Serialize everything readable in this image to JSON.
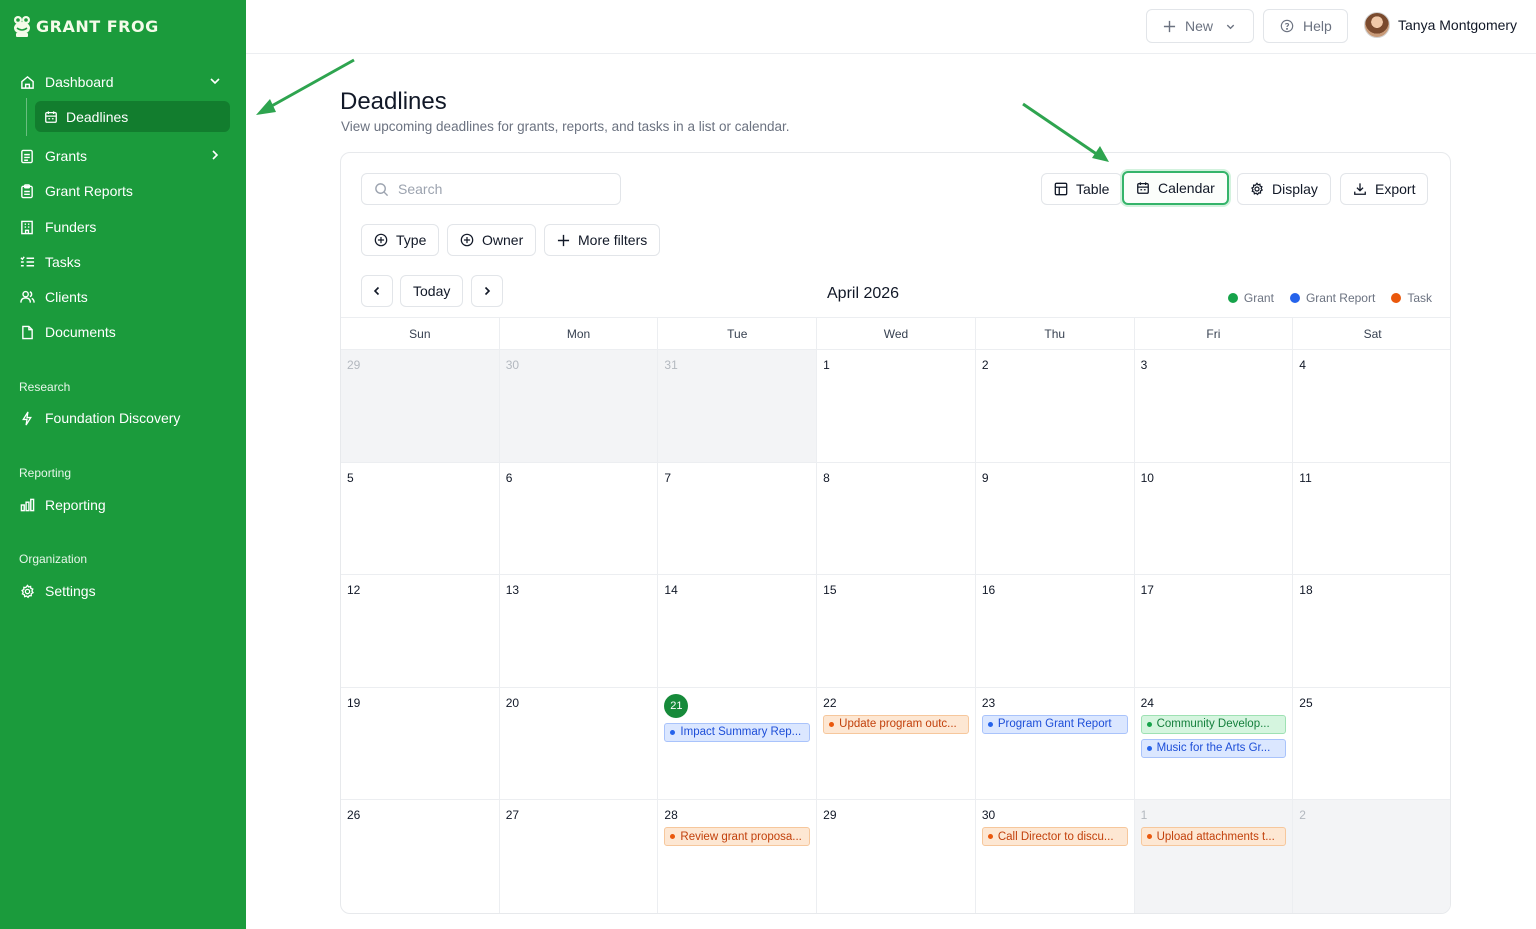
{
  "brand": {
    "name": "GRANT FROG"
  },
  "sidebar": {
    "items": [
      {
        "label": "Dashboard",
        "icon": "home-icon"
      },
      {
        "label": "Deadlines",
        "icon": "calendar-icon"
      },
      {
        "label": "Grants",
        "icon": "document-icon"
      },
      {
        "label": "Grant Reports",
        "icon": "clipboard-icon"
      },
      {
        "label": "Funders",
        "icon": "building-icon"
      },
      {
        "label": "Tasks",
        "icon": "list-check-icon"
      },
      {
        "label": "Clients",
        "icon": "users-icon"
      },
      {
        "label": "Documents",
        "icon": "file-icon"
      }
    ],
    "sections": [
      {
        "title": "Research",
        "items": [
          {
            "label": "Foundation Discovery",
            "icon": "sparkle-icon"
          }
        ]
      },
      {
        "title": "Reporting",
        "items": [
          {
            "label": "Reporting",
            "icon": "bar-chart-icon"
          }
        ]
      },
      {
        "title": "Organization",
        "items": [
          {
            "label": "Settings",
            "icon": "gear-icon"
          }
        ]
      }
    ]
  },
  "topbar": {
    "new_label": "New",
    "help_label": "Help",
    "user_name": "Tanya Montgomery"
  },
  "page": {
    "title": "Deadlines",
    "subtitle": "View upcoming deadlines for grants, reports, and tasks in a list or calendar."
  },
  "toolbar": {
    "search_placeholder": "Search",
    "table_label": "Table",
    "calendar_label": "Calendar",
    "display_label": "Display",
    "export_label": "Export",
    "filters": [
      "Type",
      "Owner",
      "More filters"
    ],
    "today_label": "Today"
  },
  "calendar": {
    "month_title": "April 2026",
    "legend": [
      {
        "label": "Grant",
        "color": "#16a34a"
      },
      {
        "label": "Grant Report",
        "color": "#2563eb"
      },
      {
        "label": "Task",
        "color": "#ea580c"
      }
    ],
    "days_of_week": [
      "Sun",
      "Mon",
      "Tue",
      "Wed",
      "Thu",
      "Fri",
      "Sat"
    ],
    "today": "21",
    "weeks": [
      [
        {
          "n": "29",
          "out": true
        },
        {
          "n": "30",
          "out": true
        },
        {
          "n": "31",
          "out": true
        },
        {
          "n": "1"
        },
        {
          "n": "2"
        },
        {
          "n": "3"
        },
        {
          "n": "4"
        }
      ],
      [
        {
          "n": "5"
        },
        {
          "n": "6"
        },
        {
          "n": "7"
        },
        {
          "n": "8"
        },
        {
          "n": "9"
        },
        {
          "n": "10"
        },
        {
          "n": "11"
        }
      ],
      [
        {
          "n": "12"
        },
        {
          "n": "13"
        },
        {
          "n": "14"
        },
        {
          "n": "15"
        },
        {
          "n": "16"
        },
        {
          "n": "17"
        },
        {
          "n": "18"
        }
      ],
      [
        {
          "n": "19"
        },
        {
          "n": "20"
        },
        {
          "n": "21",
          "events": [
            {
              "type": "report",
              "title": "Impact Summary Rep..."
            }
          ]
        },
        {
          "n": "22",
          "events": [
            {
              "type": "task",
              "title": "Update program outc..."
            }
          ]
        },
        {
          "n": "23",
          "events": [
            {
              "type": "report",
              "title": "Program Grant Report"
            }
          ]
        },
        {
          "n": "24",
          "events": [
            {
              "type": "grant",
              "title": "Community Develop..."
            },
            {
              "type": "report",
              "title": "Music for the Arts Gr..."
            }
          ]
        },
        {
          "n": "25"
        }
      ],
      [
        {
          "n": "26"
        },
        {
          "n": "27"
        },
        {
          "n": "28",
          "events": [
            {
              "type": "task",
              "title": "Review grant proposa..."
            }
          ]
        },
        {
          "n": "29"
        },
        {
          "n": "30",
          "events": [
            {
              "type": "task",
              "title": "Call Director to discu..."
            }
          ]
        },
        {
          "n": "1",
          "out": true,
          "events": [
            {
              "type": "task",
              "title": "Upload attachments t..."
            }
          ]
        },
        {
          "n": "2",
          "out": true
        }
      ]
    ]
  }
}
